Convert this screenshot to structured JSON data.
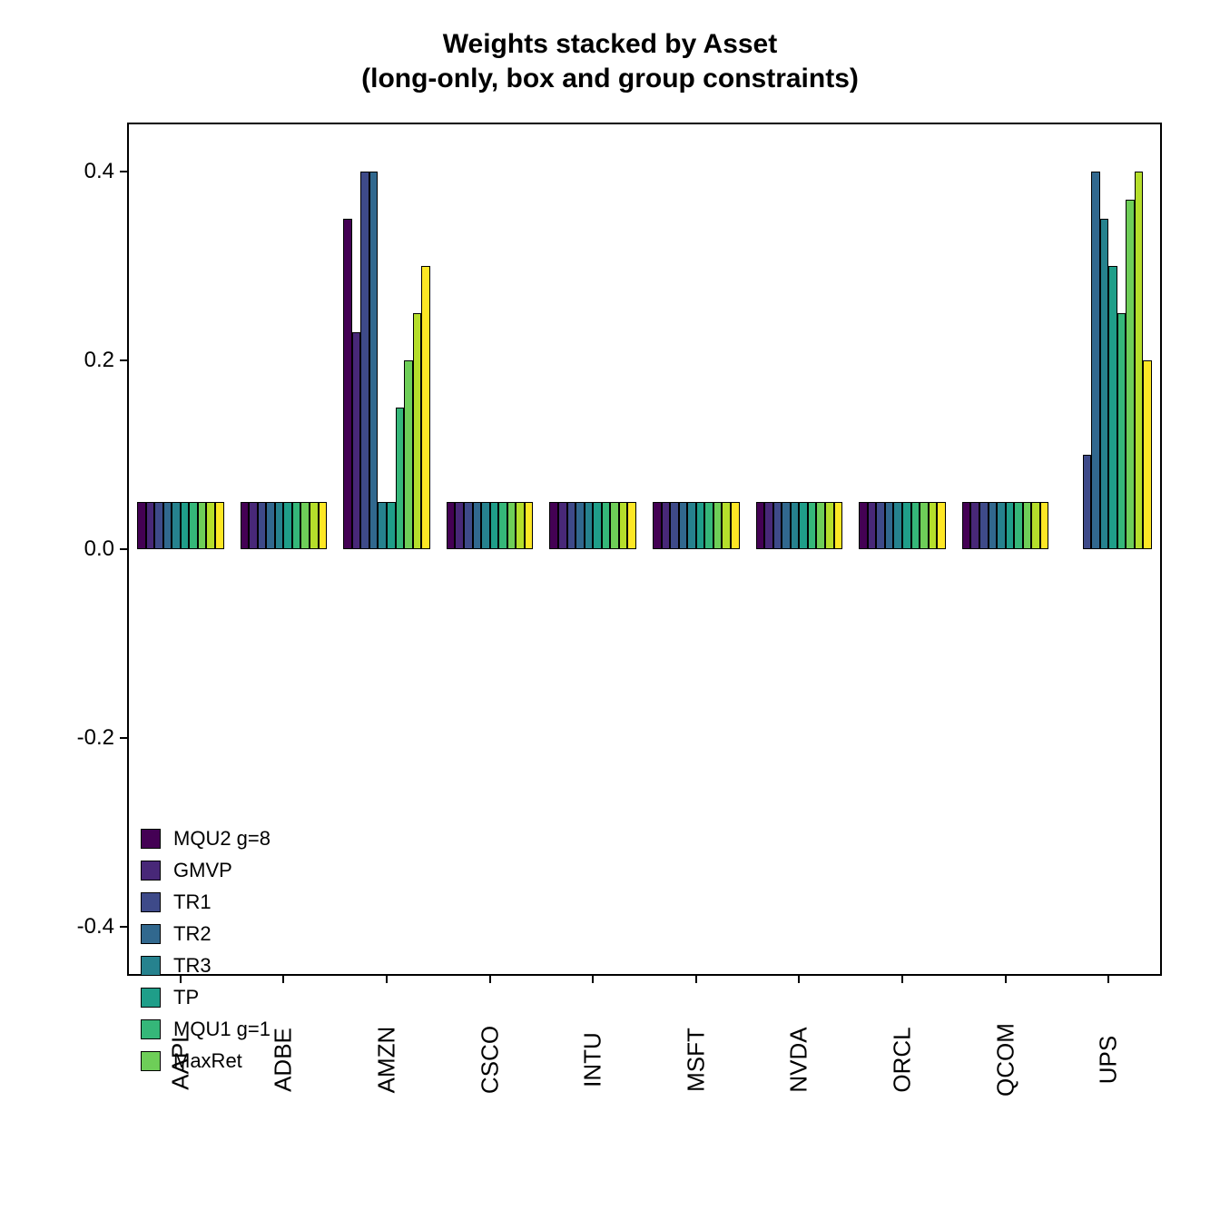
{
  "chart_data": {
    "type": "bar",
    "title": "Weights stacked by Asset\n(long-only, box and group constraints)",
    "xlabel": "",
    "ylabel": "",
    "ylim": [
      -0.45,
      0.45
    ],
    "y_ticks": [
      -0.4,
      -0.2,
      0.0,
      0.2,
      0.4
    ],
    "categories": [
      "AAPL",
      "ADBE",
      "AMZN",
      "CSCO",
      "INTU",
      "MSFT",
      "NVDA",
      "ORCL",
      "QCOM",
      "UPS"
    ],
    "series": [
      {
        "name": "MQU2 g=8",
        "color": "#440154",
        "values": [
          0.05,
          0.05,
          0.35,
          0.05,
          0.05,
          0.05,
          0.05,
          0.05,
          0.05,
          0.0
        ]
      },
      {
        "name": "GMVP",
        "color": "#482878",
        "values": [
          0.05,
          0.05,
          0.23,
          0.05,
          0.05,
          0.05,
          0.05,
          0.05,
          0.05,
          0.0
        ]
      },
      {
        "name": "TR1",
        "color": "#3e4a89",
        "values": [
          0.05,
          0.05,
          0.4,
          0.05,
          0.05,
          0.05,
          0.05,
          0.05,
          0.05,
          0.1
        ]
      },
      {
        "name": "TR2",
        "color": "#31688e",
        "values": [
          0.05,
          0.05,
          0.4,
          0.05,
          0.05,
          0.05,
          0.05,
          0.05,
          0.05,
          0.4
        ]
      },
      {
        "name": "TR3",
        "color": "#26828e",
        "values": [
          0.05,
          0.05,
          0.05,
          0.05,
          0.05,
          0.05,
          0.05,
          0.05,
          0.05,
          0.35
        ]
      },
      {
        "name": "TP",
        "color": "#1f9e89",
        "values": [
          0.05,
          0.05,
          0.05,
          0.05,
          0.05,
          0.05,
          0.05,
          0.05,
          0.05,
          0.3
        ]
      },
      {
        "name": "MQU1 g=1",
        "color": "#35b779",
        "values": [
          0.05,
          0.05,
          0.15,
          0.05,
          0.05,
          0.05,
          0.05,
          0.05,
          0.05,
          0.25
        ]
      },
      {
        "name": "MaxRet",
        "color": "#6ece58",
        "values": [
          0.05,
          0.05,
          0.2,
          0.05,
          0.05,
          0.05,
          0.05,
          0.05,
          0.05,
          0.37
        ]
      },
      {
        "name": "",
        "color": "#b5de2b",
        "values": [
          0.05,
          0.05,
          0.25,
          0.05,
          0.05,
          0.05,
          0.05,
          0.05,
          0.05,
          0.4
        ]
      },
      {
        "name": "",
        "color": "#fde725",
        "values": [
          0.05,
          0.05,
          0.3,
          0.05,
          0.05,
          0.05,
          0.05,
          0.05,
          0.05,
          0.2
        ]
      }
    ],
    "legend_entries": [
      "MQU2 g=8",
      "GMVP",
      "TR1",
      "TR2",
      "TR3",
      "TP",
      "MQU1 g=1",
      "MaxRet"
    ],
    "legend_position": "bottom-left"
  }
}
